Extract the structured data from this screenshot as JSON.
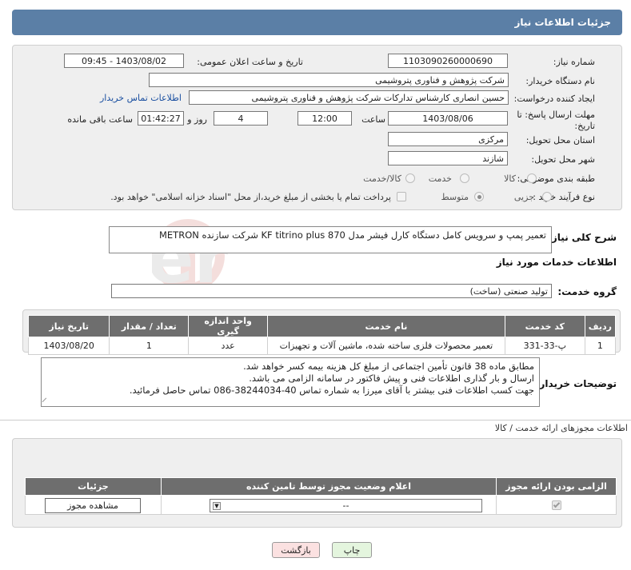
{
  "header": {
    "title": "جزئیات اطلاعات نیاز"
  },
  "form": {
    "need_number_label": "شماره نیاز:",
    "need_number": "1103090260000690",
    "announce_label": "تاریخ و ساعت اعلان عمومی:",
    "announce_value": "1403/08/02 - 09:45",
    "buyer_org_label": "نام دستگاه خریدار:",
    "buyer_org": "شرکت پژوهش و فناوری پتروشیمی",
    "requester_label": "ایجاد کننده درخواست:",
    "requester": "حسین انصاری کارشناس تدارکات شرکت پژوهش و فناوری پتروشیمی",
    "buyer_contact_link": "اطلاعات تماس خریدار",
    "deadline_label": "مهلت ارسال پاسخ: تا تاریخ:",
    "deadline_date": "1403/08/06",
    "time_label": "ساعت",
    "deadline_time": "12:00",
    "days_value": "4",
    "days_label": "روز و",
    "remaining_time": "01:42:27",
    "remaining_label": "ساعت باقی مانده",
    "province_label": "استان محل تحویل:",
    "province": "مرکزی",
    "city_label": "شهر محل تحویل:",
    "city": "شازند",
    "category_label": "طبقه بندی موضوعی:",
    "category_options": [
      "کالا",
      "خدمت",
      "کالا/خدمت"
    ],
    "process_label": "نوع فرآیند خرید :",
    "process_options": [
      "جزیی",
      "متوسط"
    ],
    "payment_note": "پرداخت تمام یا بخشی از مبلغ خرید،از محل \"اسناد خزانه اسلامی\" خواهد بود."
  },
  "description": {
    "label": "شرح کلی نیاز:",
    "text": "تعمیر پمپ و سرویس کامل دستگاه کارل فیشر مدل KF titrino plus 870 شرکت سازنده METRON"
  },
  "services": {
    "title": "اطلاعات خدمات مورد نیاز",
    "group_label": "گروه خدمت:",
    "group_value": "تولید صنعتی (ساخت)",
    "columns": [
      "ردیف",
      "کد خدمت",
      "نام خدمت",
      "واحد اندازه گیری",
      "تعداد / مقدار",
      "تاریخ نیاز"
    ],
    "rows": [
      [
        "1",
        "پ-33-331",
        "تعمیر محصولات فلزی ساخته شده، ماشین آلات و تجهیزات",
        "عدد",
        "1",
        "1403/08/20"
      ]
    ]
  },
  "buyer_notes": {
    "label": "توضیحات خریدار:",
    "lines": [
      "مطابق ماده 38 قانون تأمین اجتماعی از مبلغ کل هزینه بیمه کسر خواهد شد.",
      "ارسال و بار گذاری اطلاعات فنی و پیش فاکتور در سامانه الزامی می باشد.",
      "جهت کسب اطلاعات فنی بیشتر با آقای میرزا به شماره تماس  40-38244034-086 تماس حاصل فرمائید."
    ]
  },
  "permits": {
    "title": "اطلاعات مجوزهای ارائه خدمت / کالا",
    "columns": [
      "الزامی بودن ارائه مجوز",
      "اعلام وضعیت مجوز توسط تامین کننده",
      "جزئیات"
    ],
    "select_value": "--",
    "view_button": "مشاهده مجوز"
  },
  "buttons": {
    "print": "چاپ",
    "back": "بازگشت"
  },
  "colors": {
    "header_bg": "#5b7fa6",
    "table_header_bg": "#6e6e6e",
    "link": "#1a4fa0"
  }
}
